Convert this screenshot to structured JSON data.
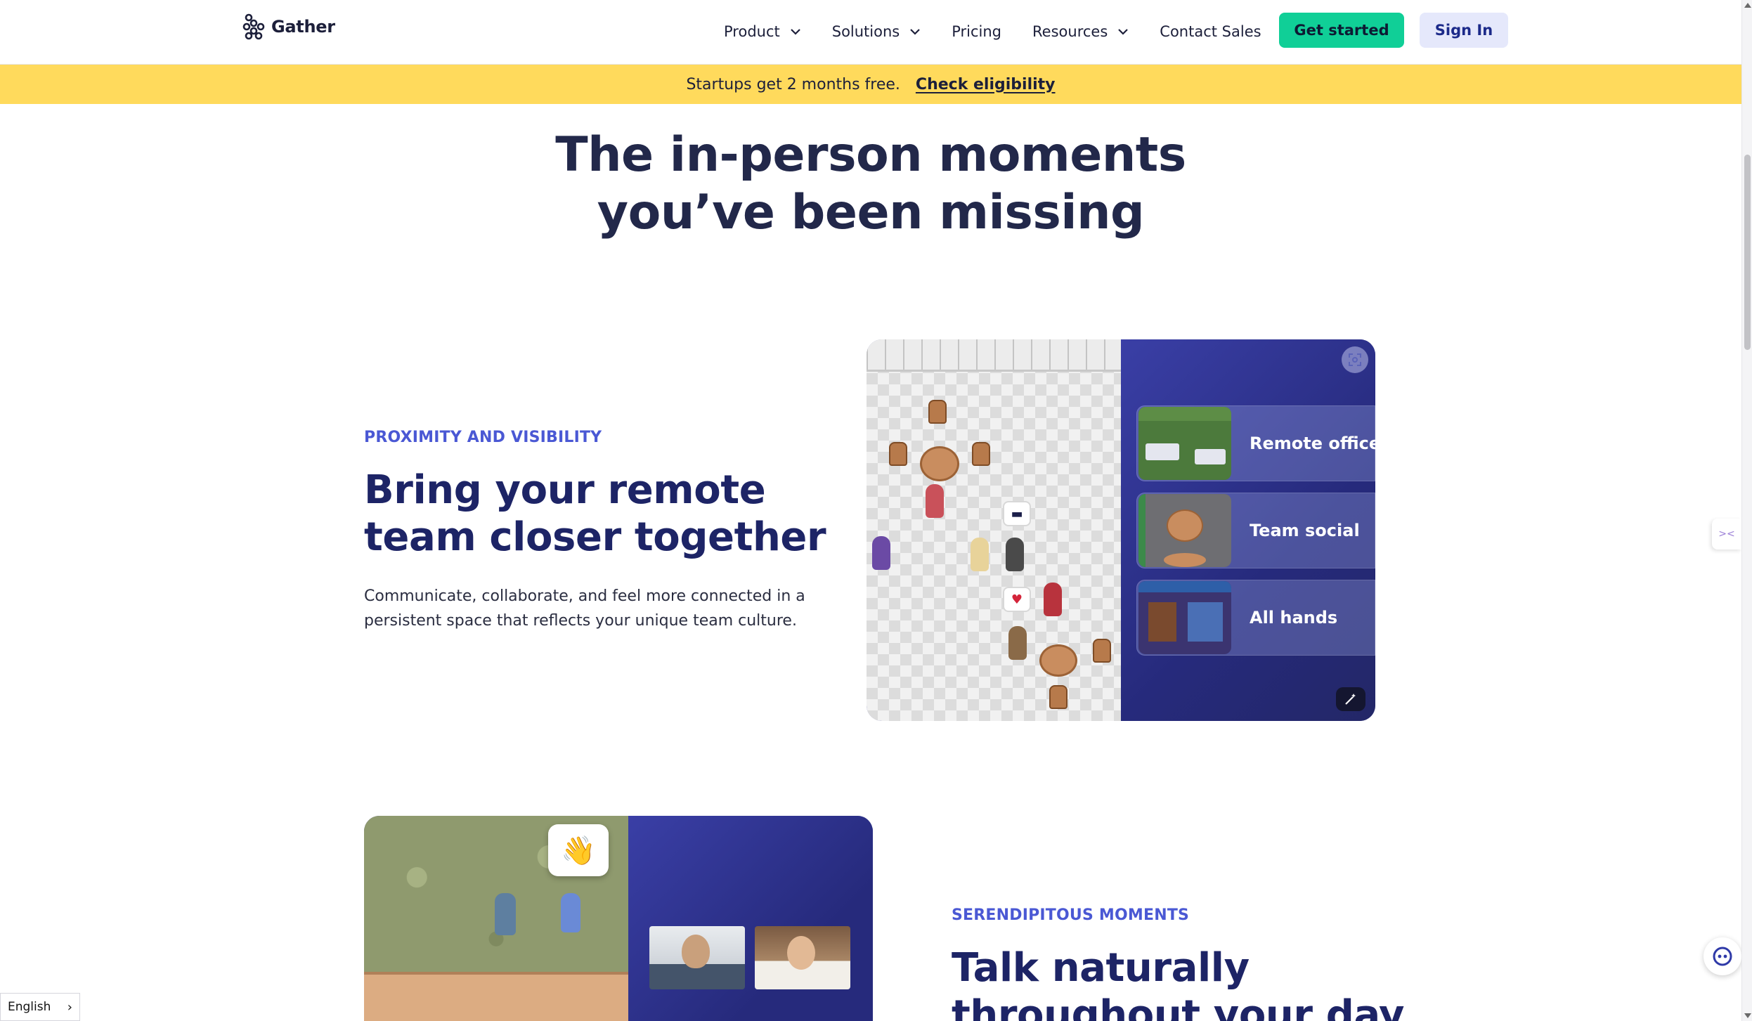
{
  "header": {
    "logo_text": "Gather",
    "nav": [
      {
        "label": "Product",
        "has_dropdown": true
      },
      {
        "label": "Solutions",
        "has_dropdown": true
      },
      {
        "label": "Pricing",
        "has_dropdown": false
      },
      {
        "label": "Resources",
        "has_dropdown": true
      },
      {
        "label": "Contact Sales",
        "has_dropdown": false
      }
    ],
    "get_started_label": "Get started",
    "sign_in_label": "Sign In"
  },
  "banner": {
    "text": "Startups get 2 months free.",
    "cta": "Check eligibility"
  },
  "hero": {
    "title_line1": "The in-person moments",
    "title_line2": "you’ve been missing"
  },
  "section1": {
    "eyebrow": "PROXIMITY AND VISIBILITY",
    "title_line1": "Bring your remote",
    "title_line2": "team closer together",
    "body_line1": "Communicate, collaborate, and feel more connected in a",
    "body_line2": "persistent space that reflects your unique team culture.",
    "menu": [
      {
        "label": "Remote office"
      },
      {
        "label": "Team social"
      },
      {
        "label": "All hands"
      }
    ]
  },
  "section2": {
    "eyebrow": "SERENDIPITOUS MOMENTS",
    "title_line1": "Talk naturally",
    "title_line2": "throughout your day"
  },
  "footer_widgets": {
    "language": "English"
  },
  "colors": {
    "accent_green": "#10cf97",
    "banner_yellow": "#ffda5c",
    "eyebrow_blue": "#4a58d4",
    "heading_navy": "#1d2466",
    "card_indigo": "#2a2f8f"
  },
  "icons": [
    "gather-logo-icon",
    "chevron-down-icon",
    "fullscreen-icon",
    "magic-wand-icon",
    "chevron-right-icon",
    "chat-widget-icon",
    "side-widget-icon"
  ]
}
